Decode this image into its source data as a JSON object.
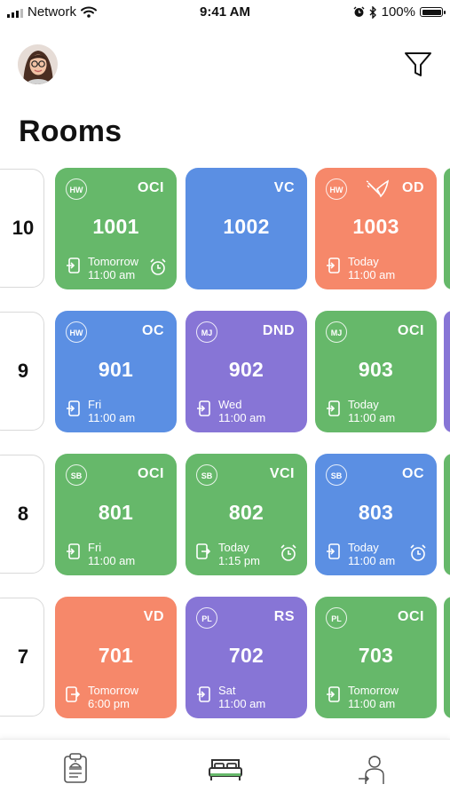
{
  "status_bar": {
    "carrier": "Network",
    "time": "9:41 AM",
    "battery": "100%"
  },
  "header": {
    "title": "Rooms"
  },
  "colors": {
    "green": "#66b86a",
    "blue": "#5b8fe3",
    "orange": "#f6886a",
    "purple": "#8775d6"
  },
  "floors": [
    {
      "floor": "10",
      "rooms": [
        {
          "initials": "HW",
          "status": "OCI",
          "number": "1001",
          "day": "Tomorrow",
          "time": "11:00 am",
          "color": "#66b86a",
          "clock": true,
          "broom": false,
          "check": "out"
        },
        {
          "initials": "",
          "status": "VC",
          "number": "1002",
          "day": "",
          "time": "",
          "color": "#5b8fe3",
          "clock": false,
          "broom": false,
          "check": ""
        },
        {
          "initials": "HW",
          "status": "OD",
          "number": "1003",
          "day": "Today",
          "time": "11:00 am",
          "color": "#f6886a",
          "clock": false,
          "broom": true,
          "check": "out"
        }
      ],
      "peek_color": "#66b86a"
    },
    {
      "floor": "9",
      "rooms": [
        {
          "initials": "HW",
          "status": "OC",
          "number": "901",
          "day": "Fri",
          "time": "11:00 am",
          "color": "#5b8fe3",
          "clock": false,
          "broom": false,
          "check": "out"
        },
        {
          "initials": "MJ",
          "status": "DND",
          "number": "902",
          "day": "Wed",
          "time": "11:00 am",
          "color": "#8775d6",
          "clock": false,
          "broom": false,
          "check": "out"
        },
        {
          "initials": "MJ",
          "status": "OCI",
          "number": "903",
          "day": "Today",
          "time": "11:00 am",
          "color": "#66b86a",
          "clock": false,
          "broom": false,
          "check": "out"
        }
      ],
      "peek_color": "#8775d6"
    },
    {
      "floor": "8",
      "rooms": [
        {
          "initials": "SB",
          "status": "OCI",
          "number": "801",
          "day": "Fri",
          "time": "11:00 am",
          "color": "#66b86a",
          "clock": false,
          "broom": false,
          "check": "out"
        },
        {
          "initials": "SB",
          "status": "VCI",
          "number": "802",
          "day": "Today",
          "time": "1:15 pm",
          "color": "#66b86a",
          "clock": true,
          "broom": false,
          "check": "in"
        },
        {
          "initials": "SB",
          "status": "OC",
          "number": "803",
          "day": "Today",
          "time": "11:00 am",
          "color": "#5b8fe3",
          "clock": true,
          "broom": false,
          "check": "out"
        }
      ],
      "peek_color": "#66b86a"
    },
    {
      "floor": "7",
      "rooms": [
        {
          "initials": "",
          "status": "VD",
          "number": "701",
          "day": "Tomorrow",
          "time": "6:00 pm",
          "color": "#f6886a",
          "clock": false,
          "broom": false,
          "check": "in"
        },
        {
          "initials": "PL",
          "status": "RS",
          "number": "702",
          "day": "Sat",
          "time": "11:00 am",
          "color": "#8775d6",
          "clock": false,
          "broom": false,
          "check": "out"
        },
        {
          "initials": "PL",
          "status": "OCI",
          "number": "703",
          "day": "Tomorrow",
          "time": "11:00 am",
          "color": "#66b86a",
          "clock": false,
          "broom": false,
          "check": "out"
        }
      ],
      "peek_color": "#66b86a"
    }
  ],
  "nav": {
    "items": [
      "clipboard-icon",
      "bed-icon",
      "housekeeper-icon"
    ],
    "active": "bed-icon"
  }
}
